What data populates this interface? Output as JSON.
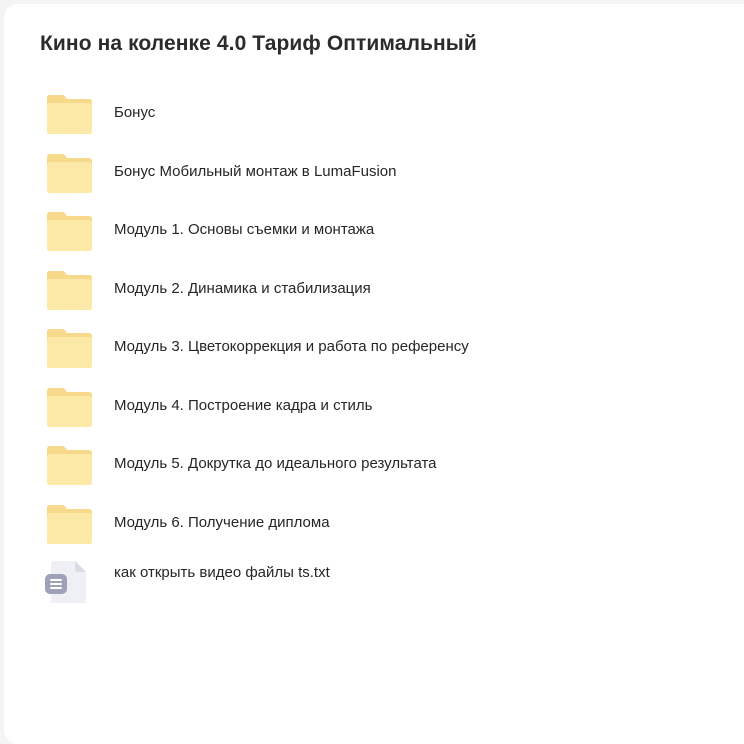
{
  "page": {
    "title": "Кино на коленке 4.0 Тариф Оптимальный"
  },
  "colors": {
    "folder_back": "#f6d98a",
    "folder_front": "#fde9a7",
    "file_body": "#eff0f6",
    "file_fold": "#d8dae6",
    "file_badge": "#9ea2b8"
  },
  "items": [
    {
      "label": "Бонус",
      "type": "folder",
      "icon": "folder-icon"
    },
    {
      "label": "Бонус Мобильный монтаж в LumaFusion",
      "type": "folder",
      "icon": "folder-icon"
    },
    {
      "label": "Модуль 1. Основы съемки и монтажа",
      "type": "folder",
      "icon": "folder-icon"
    },
    {
      "label": "Модуль 2. Динамика и стабилизация",
      "type": "folder",
      "icon": "folder-icon"
    },
    {
      "label": "Модуль 3. Цветокоррекция и работа по референсу",
      "type": "folder",
      "icon": "folder-icon"
    },
    {
      "label": "Модуль 4. Построение кадра и стиль",
      "type": "folder",
      "icon": "folder-icon"
    },
    {
      "label": "Модуль 5. Докрутка до идеального результата",
      "type": "folder",
      "icon": "folder-icon"
    },
    {
      "label": "Модуль 6. Получение диплома",
      "type": "folder",
      "icon": "folder-icon"
    },
    {
      "label": "как открыть видео файлы ts.txt",
      "type": "file",
      "icon": "text-file-icon"
    }
  ]
}
